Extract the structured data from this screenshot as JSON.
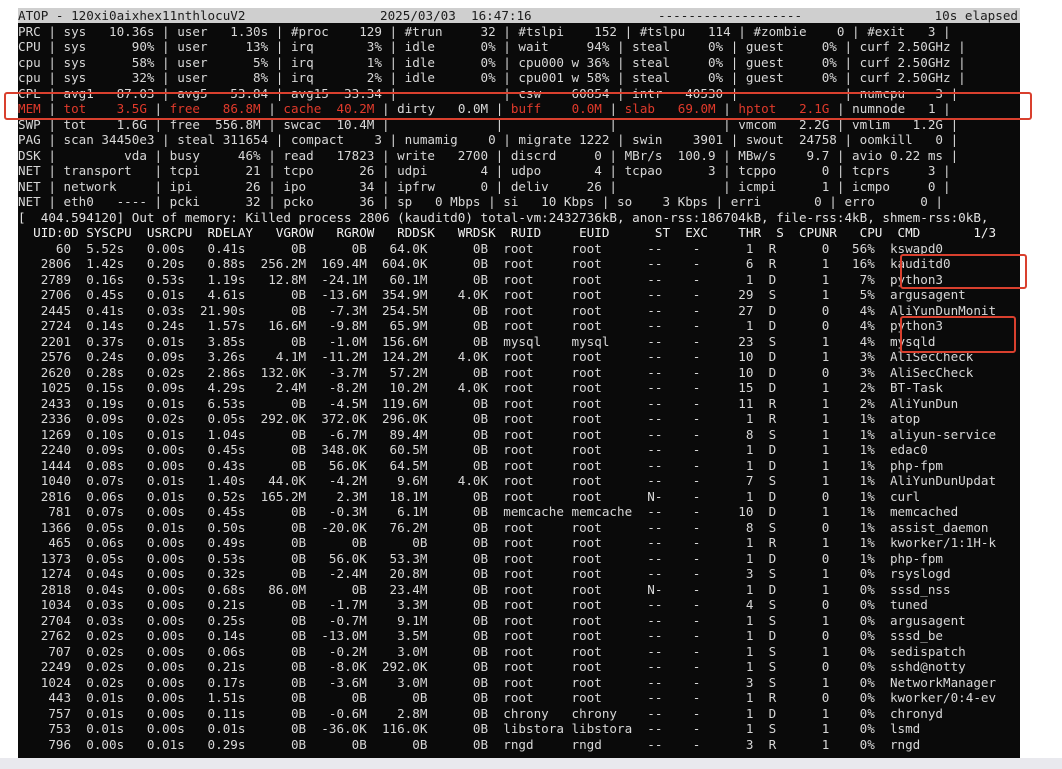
{
  "terminal": {
    "title": "ATOP - 120xi0aixhex11nthlocuV2",
    "date": "2025/03/03  16:47:16",
    "dashes": "-------------------",
    "elapsed": "10s elapsed",
    "system_lines": [
      "PRC | sys   10.36s | user   1.30s | #proc    129 | #trun     32 | #tslpi    152 | #tslpu   114 | #zombie    0 | #exit   3 |",
      "CPU | sys      90% | user     13% | irq       3% | idle      0% | wait     94% | steal     0% | guest     0% | curf 2.50GHz |",
      "cpu | sys      58% | user      5% | irq       1% | idle      0% | cpu000 w 36% | steal     0% | guest     0% | curf 2.50GHz |",
      "cpu | sys      32% | user      8% | irq       2% | idle      0% | cpu001 w 58% | steal     0% | guest     0% | curf 2.50GHz |",
      "CPL | avg1   87.03 | avg5   53.84 | avg15  33.34 |              | csw    60854 | intr   40530 |              | numcpu    3 |"
    ],
    "mem_line": {
      "tag": "MEM",
      "tot": "tot    3.5G",
      "free": "free   86.8M",
      "cache": "cache  40.2M",
      "dirty": "dirty   0.0M",
      "buff": "buff    0.0M",
      "slab": "slab   69.0M",
      "hptot": "hptot   2.1G",
      "numnode": "numnode   1"
    },
    "system_lines_2": [
      "SWP | tot    1.6G | free  556.8M | swcac  10.4M |              |              |              | vmcom   2.2G | vmlim   1.2G |",
      "PAG | scan 34450e3 | steal 311654 | compact    3 | numamig    0 | migrate 1222 | swin    3901 | swout  24758 | oomkill   0 |",
      "DSK |         vda | busy     46% | read   17823 | write   2700 | discrd     0 | MBr/s  100.9 | MBw/s    9.7 | avio 0.22 ms |",
      "NET | transport   | tcpi      21 | tcpo      26 | udpi       4 | udpo       4 | tcpao      3 | tcppo      0 | tcprs     3 |",
      "NET | network     | ipi       26 | ipo       34 | ipfrw      0 | deliv     26 |              | icmpi      1 | icmpo     0 |",
      "NET | eth0   ---- | pcki      32 | pcko      36 | sp   0 Mbps | si   10 Kbps | so    3 Kbps | erri       0 | erro      0 |"
    ],
    "oom_message": "[  404.594120] Out of memory: Killed process 2806 (kauditd0) total-vm:2432736kB, anon-rss:186704kB, file-rss:4kB, shmem-rss:0kB,",
    "process_header": "  UID:0D SYSCPU  USRCPU  RDELAY   VGROW   RGROW   RDDSK   WRDSK  RUID     EUID      ST  EXC    THR  S  CPUNR   CPU  CMD       1/3",
    "process_rows": [
      "     60  5.52s   0.00s   0.41s      0B      0B   64.0K      0B  root     root      --    -      1  R      0   56%  kswapd0",
      "   2806  1.42s   0.20s   0.88s  256.2M  169.4M  604.0K      0B  root     root      --    -      6  R      1   16%  kauditd0",
      "   2789  0.16s   0.53s   1.19s   12.8M  -24.1M   60.1M      0B  root     root      --    -      1  D      1    7%  python3",
      "   2706  0.45s   0.01s   4.61s      0B  -13.6M  354.9M    4.0K  root     root      --    -     29  S      1    5%  argusagent",
      "   2445  0.41s   0.03s  21.90s      0B   -7.3M  254.5M      0B  root     root      --    -     27  D      0    4%  AliYunDunMonit",
      "   2724  0.14s   0.24s   1.57s   16.6M   -9.8M   65.9M      0B  root     root      --    -      1  D      0    4%  python3",
      "   2201  0.37s   0.01s   3.85s      0B   -1.0M  156.6M      0B  mysql    mysql     --    -     23  S      1    4%  mysqld",
      "   2576  0.24s   0.09s   3.26s    4.1M  -11.2M  124.2M    4.0K  root     root      --    -     10  D      1    3%  AliSecCheck",
      "   2620  0.28s   0.02s   2.86s  132.0K   -3.7M   57.2M      0B  root     root      --    -     10  D      0    3%  AliSecCheck",
      "   1025  0.15s   0.09s   4.29s    2.4M   -8.2M   10.2M    4.0K  root     root      --    -     15  D      1    2%  BT-Task",
      "   2433  0.19s   0.01s   6.53s      0B   -4.5M  119.6M      0B  root     root      --    -     11  R      1    2%  AliYunDun",
      "   2336  0.09s   0.02s   0.05s  292.0K  372.0K  296.0K      0B  root     root      --    -      1  R      1    1%  atop",
      "   1269  0.10s   0.01s   1.04s      0B   -6.7M   89.4M      0B  root     root      --    -      8  S      1    1%  aliyun-service",
      "   2240  0.09s   0.00s   0.45s      0B  348.0K   60.5M      0B  root     root      --    -      1  D      1    1%  edac0",
      "   1444  0.08s   0.00s   0.43s      0B   56.0K   64.5M      0B  root     root      --    -      1  D      1    1%  php-fpm",
      "   1040  0.07s   0.01s   1.40s   44.0K   -4.2M    9.6M    4.0K  root     root      --    -      7  S      1    1%  AliYunDunUpdat",
      "   2816  0.06s   0.01s   0.52s  165.2M    2.3M   18.1M      0B  root     root      N-    -      1  D      0    1%  curl",
      "    781  0.07s   0.00s   0.45s      0B   -0.3M    6.1M      0B  memcache memcache  --    -     10  D      1    1%  memcached",
      "   1366  0.05s   0.01s   0.50s      0B  -20.0K   76.2M      0B  root     root      --    -      8  S      0    1%  assist_daemon",
      "    465  0.06s   0.00s   0.49s      0B      0B      0B      0B  root     root      --    -      1  R      1    1%  kworker/1:1H-k",
      "   1373  0.05s   0.00s   0.53s      0B   56.0K   53.3M      0B  root     root      --    -      1  D      0    1%  php-fpm",
      "   1274  0.04s   0.00s   0.32s      0B   -2.4M   20.8M      0B  root     root      --    -      3  S      1    0%  rsyslogd",
      "   2818  0.04s   0.00s   0.68s   86.0M      0B   23.4M      0B  root     root      N-    -      1  D      1    0%  sssd_nss",
      "   1034  0.03s   0.00s   0.21s      0B   -1.7M    3.3M      0B  root     root      --    -      4  S      0    0%  tuned",
      "   2704  0.03s   0.00s   0.25s      0B   -0.7M    9.1M      0B  root     root      --    -      1  S      1    0%  argusagent",
      "   2762  0.02s   0.00s   0.14s      0B  -13.0M    3.5M      0B  root     root      --    -      1  D      0    0%  sssd_be",
      "    707  0.02s   0.00s   0.06s      0B   -0.2M    3.0M      0B  root     root      --    -      1  S      1    0%  sedispatch",
      "   2249  0.02s   0.00s   0.21s      0B   -8.0K  292.0K      0B  root     root      --    -      1  S      0    0%  sshd@notty",
      "   1024  0.02s   0.00s   0.17s      0B   -3.6M    3.0M      0B  root     root      --    -      3  S      1    0%  NetworkManager",
      "    443  0.01s   0.00s   1.51s      0B      0B      0B      0B  root     root      --    -      1  R      0    0%  kworker/0:4-ev",
      "    757  0.01s   0.00s   0.11s      0B   -0.6M    2.8M      0B  chrony   chrony    --    -      1  D      1    0%  chronyd",
      "    753  0.01s   0.00s   0.01s      0B  -36.0K  116.0K      0B  libstora libstora  --    -      1  S      1    0%  lsmd",
      "    796  0.00s   0.01s   0.29s      0B      0B      0B      0B  rngd     rngd      --    -      3  R      1    0%  rngd"
    ]
  },
  "colors": {
    "screen_bg": "#0a0a0a",
    "text": "#d8d8d8",
    "alert_red": "#e13a2b",
    "highlight_box": "#d9402e"
  }
}
